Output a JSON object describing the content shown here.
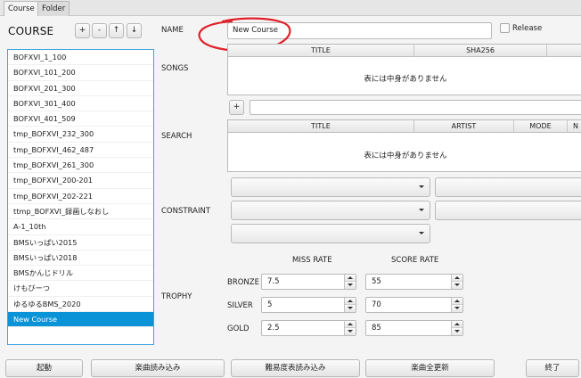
{
  "tabs": [
    {
      "label": "Course",
      "active": true
    },
    {
      "label": "Folder",
      "active": false
    }
  ],
  "course_panel": {
    "title": "COURSE",
    "buttons": [
      "+",
      "-",
      "↑",
      "↓"
    ],
    "items": [
      "BOFXVI_1_100",
      "BOFXVI_101_200",
      "BOFXVI_201_300",
      "BOFXVI_301_400",
      "BOFXVI_401_509",
      "tmp_BOFXVI_232_300",
      "tmp_BOFXVI_462_487",
      "tmp_BOFXVI_261_300",
      "tmp_BOFXVI_200-201",
      "tmp_BOFXVI_202-221",
      "ttmp_BOFXVI_録画しなおし",
      "A-1_10th",
      "BMSいっぱい2015",
      "BMSいっぱい2018",
      "BMSかんじドリル",
      "けもびーつ",
      "ゆるゆるBMS_2020",
      "New Course"
    ],
    "selected_index": 17
  },
  "form": {
    "name_label": "NAME",
    "name_value": "New Course",
    "release_label": "Release",
    "songs_label": "SONGS",
    "songs_table": {
      "columns": [
        "TITLE",
        "SHA256",
        ""
      ],
      "empty_message": "表には中身がありません"
    },
    "add_button": "+",
    "search_label": "SEARCH",
    "search_table": {
      "columns": [
        "TITLE",
        "ARTIST",
        "MODE",
        "N"
      ],
      "empty_message": "表には中身がありません"
    },
    "constraint_label": "CONSTRAINT",
    "trophy_label": "TROPHY",
    "miss_rate_header": "MISS RATE",
    "score_rate_header": "SCORE RATE",
    "trophies": [
      {
        "name": "BRONZE",
        "miss_rate": "7.5",
        "score_rate": "55"
      },
      {
        "name": "SILVER",
        "miss_rate": "5",
        "score_rate": "70"
      },
      {
        "name": "GOLD",
        "miss_rate": "2.5",
        "score_rate": "85"
      }
    ]
  },
  "bottom_buttons": [
    "起動",
    "楽曲読み込み",
    "難易度表読み込み",
    "楽曲全更新",
    "終了"
  ],
  "colors": {
    "selection": "#0a93d6",
    "focus_border": "#3da4e0",
    "annotation": "#e0202a"
  }
}
